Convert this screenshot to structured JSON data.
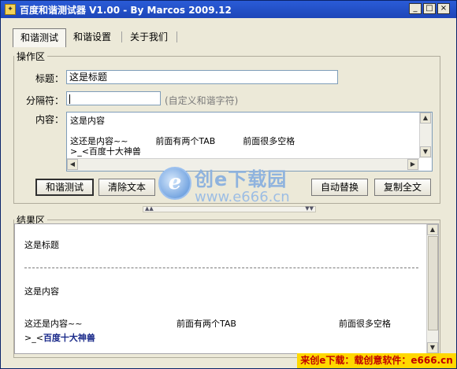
{
  "window": {
    "title": "百度和谐测试器 V1.00 - By Marcos 2009.12",
    "controls": {
      "minimize": "_",
      "maximize": "□",
      "close": "×"
    }
  },
  "tabs": [
    {
      "label": "和谐测试",
      "active": true
    },
    {
      "label": "和谐设置",
      "active": false
    },
    {
      "label": "关于我们",
      "active": false
    }
  ],
  "operation": {
    "legend": "操作区",
    "title_label": "标题：",
    "title_value": "这是标题",
    "separator_label": "分隔符：",
    "separator_value": "",
    "separator_hint": "(自定义和谐字符)",
    "content_label": "内容：",
    "content_lines": [
      "这是内容",
      "这还是内容~~          前面有两个TAB          前面很多空格",
      ">_<百度十大神兽"
    ],
    "buttons": {
      "test": "和谐测试",
      "clear": "清除文本",
      "auto_replace": "自动替换",
      "copy_all": "复制全文"
    }
  },
  "watermark": {
    "logo": "e",
    "brand": "创e下载园",
    "url": "www.e666.cn"
  },
  "result": {
    "legend": "结果区",
    "title_line": "这是标题",
    "content_line": "这是内容",
    "line2_a": "这还是内容~~",
    "line2_b": "前面有两个TAB",
    "line2_c": "前面很多空格",
    "line3_prefix": ">_<",
    "line3_bold": "百度十大神兽"
  },
  "footer": "来创e下载：载创意软件：e666.cn",
  "colors": {
    "titlebar": "#1d46b8",
    "window_bg": "#ece9d8",
    "footer_bg": "#ffd800",
    "footer_text": "#c00000"
  }
}
